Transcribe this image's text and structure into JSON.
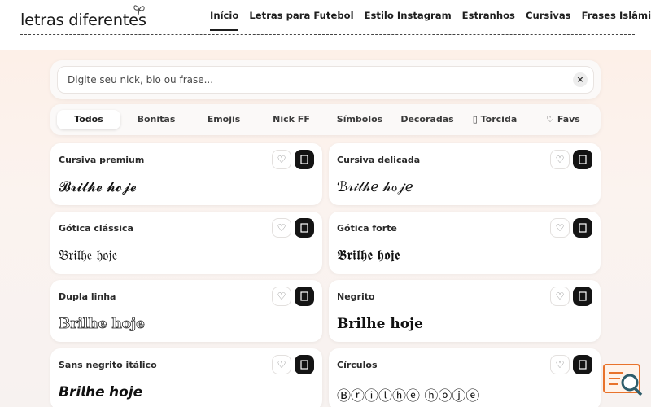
{
  "header": {
    "logo_text": "letras diferentes",
    "nav": [
      {
        "label": "Início",
        "active": true
      },
      {
        "label": "Letras para Futebol"
      },
      {
        "label": "Estilo Instagram"
      },
      {
        "label": "Estranhos"
      },
      {
        "label": "Cursivas"
      },
      {
        "label": "Frases Islâmicas"
      }
    ]
  },
  "search": {
    "placeholder": "Digite seu nick, bio ou frase...",
    "value": "",
    "clear_label": "×"
  },
  "tabs": [
    {
      "label": "Todos",
      "active": true
    },
    {
      "label": "Bonitas"
    },
    {
      "label": "Emojis"
    },
    {
      "label": "Nick FF"
    },
    {
      "label": "Símbolos"
    },
    {
      "label": "Decoradas"
    },
    {
      "label": "Torcida",
      "icon": "ball-icon"
    },
    {
      "label": "Favs",
      "icon": "heart-icon"
    }
  ],
  "cards": [
    {
      "title": "Cursiva premium",
      "preview": "𝓑𝓻𝓲𝓵𝓱𝓮 𝓱𝓸𝓳𝓮"
    },
    {
      "title": "Cursiva delicada",
      "preview": "ℬ𝓇𝒾𝓁𝒽ℯ 𝒽ℴ𝒿ℯ"
    },
    {
      "title": "Gótica clássica",
      "preview": "𝔅𝔯𝔦𝔩𝔥𝔢 𝔥𝔬𝔧𝔢"
    },
    {
      "title": "Gótica forte",
      "preview": "𝕭𝖗𝖎𝖑𝖍𝖊 𝖍𝖔𝖏𝖊"
    },
    {
      "title": "Dupla linha",
      "preview": "Brilhe hoje"
    },
    {
      "title": "Negrito",
      "preview": "Brilhe hoje"
    },
    {
      "title": "Sans negrito itálico",
      "preview": "𝘽𝙧𝙞𝙡𝙝𝙚 𝙝𝙤𝙟𝙚"
    },
    {
      "title": "Círculos",
      "preview": "Ⓑⓡⓘⓛⓗⓔ ⓗⓞⓙⓔ"
    }
  ],
  "card_buttons": {
    "fav_symbol": "♡"
  },
  "colors": {
    "accent": "#141414",
    "background_tint": "#fdf0e8",
    "badge": "#e8732c"
  }
}
